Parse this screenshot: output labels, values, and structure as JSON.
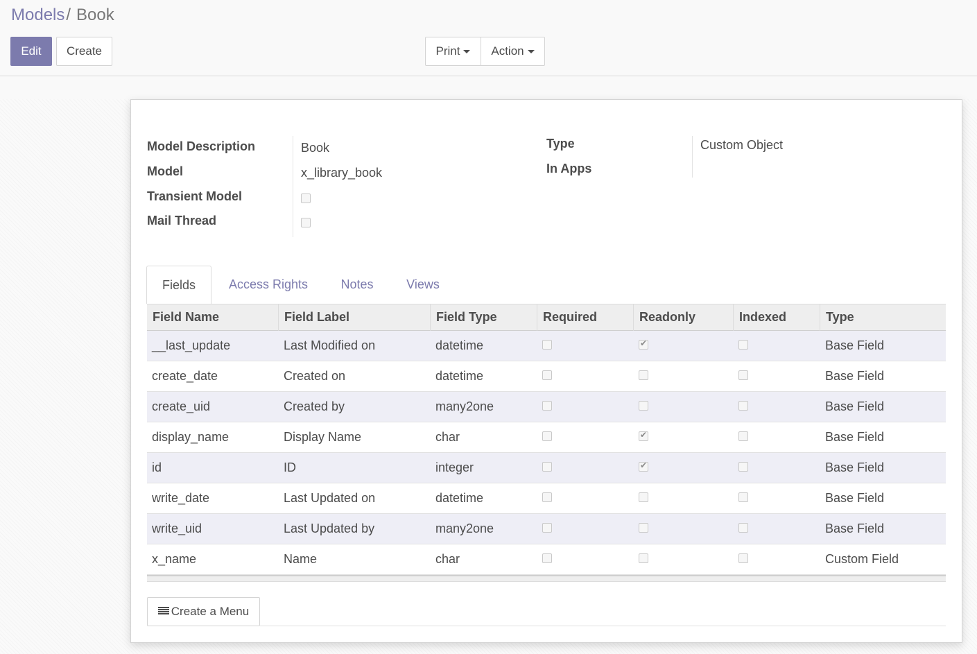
{
  "breadcrumb": {
    "parent": "Models",
    "separator": "/",
    "current": "Book"
  },
  "toolbar": {
    "edit_label": "Edit",
    "create_label": "Create",
    "print_label": "Print",
    "action_label": "Action"
  },
  "form": {
    "model_description_label": "Model Description",
    "model_description_value": "Book",
    "model_label": "Model",
    "model_value": "x_library_book",
    "transient_label": "Transient Model",
    "transient_checked": false,
    "mail_thread_label": "Mail Thread",
    "mail_thread_checked": false,
    "type_label": "Type",
    "type_value": "Custom Object",
    "in_apps_label": "In Apps",
    "in_apps_value": ""
  },
  "tabs": [
    {
      "label": "Fields",
      "active": true
    },
    {
      "label": "Access Rights",
      "active": false
    },
    {
      "label": "Notes",
      "active": false
    },
    {
      "label": "Views",
      "active": false
    }
  ],
  "table": {
    "columns": [
      "Field Name",
      "Field Label",
      "Field Type",
      "Required",
      "Readonly",
      "Indexed",
      "Type"
    ],
    "rows": [
      {
        "name": "__last_update",
        "label": "Last Modified on",
        "ftype": "datetime",
        "required": false,
        "readonly": true,
        "indexed": false,
        "type": "Base Field"
      },
      {
        "name": "create_date",
        "label": "Created on",
        "ftype": "datetime",
        "required": false,
        "readonly": false,
        "indexed": false,
        "type": "Base Field"
      },
      {
        "name": "create_uid",
        "label": "Created by",
        "ftype": "many2one",
        "required": false,
        "readonly": false,
        "indexed": false,
        "type": "Base Field"
      },
      {
        "name": "display_name",
        "label": "Display Name",
        "ftype": "char",
        "required": false,
        "readonly": true,
        "indexed": false,
        "type": "Base Field"
      },
      {
        "name": "id",
        "label": "ID",
        "ftype": "integer",
        "required": false,
        "readonly": true,
        "indexed": false,
        "type": "Base Field"
      },
      {
        "name": "write_date",
        "label": "Last Updated on",
        "ftype": "datetime",
        "required": false,
        "readonly": false,
        "indexed": false,
        "type": "Base Field"
      },
      {
        "name": "write_uid",
        "label": "Last Updated by",
        "ftype": "many2one",
        "required": false,
        "readonly": false,
        "indexed": false,
        "type": "Base Field"
      },
      {
        "name": "x_name",
        "label": "Name",
        "ftype": "char",
        "required": false,
        "readonly": false,
        "indexed": false,
        "type": "Custom Field"
      }
    ]
  },
  "create_menu_label": "Create a Menu",
  "icons": {
    "caret": "caret-down-icon",
    "menu": "bars-icon"
  },
  "colors": {
    "primary": "#7c7bad",
    "row_alt": "#eeeef6"
  }
}
